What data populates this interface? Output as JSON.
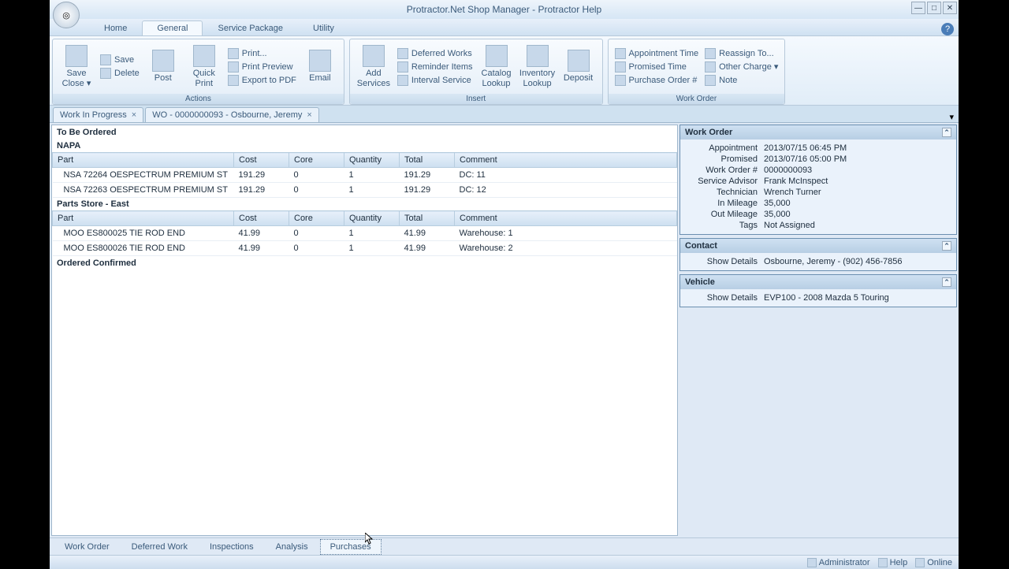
{
  "window": {
    "title": "Protractor.Net Shop Manager - Protractor Help",
    "min": "—",
    "max": "□",
    "close": "✕"
  },
  "menu": [
    "Home",
    "General",
    "Service Package",
    "Utility"
  ],
  "menu_active": 1,
  "ribbon": {
    "groups": [
      {
        "label": "Actions",
        "big": [
          {
            "label": "Save\nClose ▾",
            "name": "save-close-button"
          },
          {
            "label": "Post",
            "name": "post-button"
          },
          {
            "label": "Quick\nPrint",
            "name": "quick-print-button"
          },
          {
            "label": "Email",
            "name": "email-button"
          }
        ],
        "stack1": [
          {
            "label": "Save",
            "name": "save-button"
          },
          {
            "label": "Delete",
            "name": "delete-button"
          }
        ],
        "stack2": [
          {
            "label": "Print...",
            "name": "print-button"
          },
          {
            "label": "Print Preview",
            "name": "print-preview-button"
          },
          {
            "label": "Export to PDF",
            "name": "export-pdf-button"
          }
        ]
      },
      {
        "label": "Insert",
        "big": [
          {
            "label": "Add\nServices",
            "name": "add-services-button"
          },
          {
            "label": "Catalog\nLookup",
            "name": "catalog-lookup-button"
          },
          {
            "label": "Inventory\nLookup",
            "name": "inventory-lookup-button"
          },
          {
            "label": "Deposit",
            "name": "deposit-button"
          }
        ],
        "stack1": [
          {
            "label": "Deferred Works",
            "name": "deferred-works-button"
          },
          {
            "label": "Reminder Items",
            "name": "reminder-items-button"
          },
          {
            "label": "Interval Service",
            "name": "interval-service-button"
          }
        ]
      },
      {
        "label": "Work Order",
        "stack1": [
          {
            "label": "Appointment Time",
            "name": "appointment-time-button"
          },
          {
            "label": "Promised Time",
            "name": "promised-time-button"
          },
          {
            "label": "Purchase Order #",
            "name": "purchase-order-button"
          }
        ],
        "stack2": [
          {
            "label": "Reassign To...",
            "name": "reassign-button"
          },
          {
            "label": "Other Charge ▾",
            "name": "other-charge-button"
          },
          {
            "label": "Note",
            "name": "note-button"
          }
        ]
      }
    ]
  },
  "doc_tabs": [
    {
      "label": "Work In Progress",
      "name": "tab-wip"
    },
    {
      "label": "WO - 0000000093 - Osbourne, Jeremy",
      "name": "tab-wo"
    }
  ],
  "main": {
    "heading": "To Be Ordered",
    "vendors": [
      {
        "name": "NAPA",
        "columns": [
          "Part",
          "Cost",
          "Core",
          "Quantity",
          "Total",
          "Comment"
        ],
        "rows": [
          [
            "NSA 72264 OESPECTRUM PREMIUM ST",
            "191.29",
            "0",
            "1",
            "191.29",
            "DC: 11"
          ],
          [
            "NSA 72263 OESPECTRUM PREMIUM ST",
            "191.29",
            "0",
            "1",
            "191.29",
            "DC: 12"
          ]
        ]
      },
      {
        "name": "Parts Store - East",
        "columns": [
          "Part",
          "Cost",
          "Core",
          "Quantity",
          "Total",
          "Comment"
        ],
        "rows": [
          [
            "MOO ES800025 TIE ROD END",
            "41.99",
            "0",
            "1",
            "41.99",
            "Warehouse: 1"
          ],
          [
            "MOO ES800026 TIE ROD END",
            "41.99",
            "0",
            "1",
            "41.99",
            "Warehouse: 2"
          ]
        ]
      }
    ],
    "confirmed_heading": "Ordered Confirmed"
  },
  "side": {
    "wo": {
      "title": "Work Order",
      "rows": [
        [
          "Appointment",
          "2013/07/15 06:45 PM"
        ],
        [
          "Promised",
          "2013/07/16 05:00 PM"
        ],
        [
          "Work Order #",
          "0000000093"
        ],
        [
          "Service Advisor",
          "Frank McInspect"
        ],
        [
          "Technician",
          "Wrench Turner"
        ],
        [
          "In Mileage",
          "35,000"
        ],
        [
          "Out Mileage",
          "35,000"
        ],
        [
          "Tags",
          "Not Assigned"
        ]
      ]
    },
    "contact": {
      "title": "Contact",
      "link": "Show Details",
      "value": "Osbourne, Jeremy - (902) 456-7856"
    },
    "vehicle": {
      "title": "Vehicle",
      "link": "Show Details",
      "value": "EVP100 - 2008 Mazda 5 Touring"
    }
  },
  "bottom_tabs": [
    "Work Order",
    "Deferred Work",
    "Inspections",
    "Analysis",
    "Purchases"
  ],
  "bottom_active": 4,
  "status": [
    {
      "label": "Administrator",
      "name": "status-user"
    },
    {
      "label": "Help",
      "name": "status-help"
    },
    {
      "label": "Online",
      "name": "status-online"
    }
  ]
}
